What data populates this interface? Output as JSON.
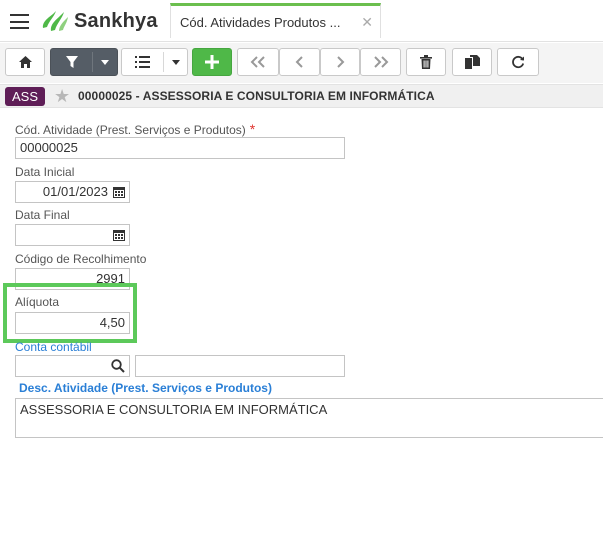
{
  "app": {
    "brand": "Sankhya"
  },
  "tab": {
    "label": "Cód. Atividades Produtos ...",
    "close": "✕"
  },
  "toolbar": {
    "buttons": [
      "home-icon",
      "filter-icon",
      "list-icon",
      "add-icon",
      "first-icon",
      "previous-icon",
      "next-icon",
      "last-icon",
      "delete-icon",
      "duplicate-icon",
      "refresh-icon"
    ]
  },
  "record": {
    "badge": "ASS",
    "title": "00000025 - ASSESSORIA E CONSULTORIA EM INFORMÁTICA"
  },
  "form": {
    "cod_atividade_label": "Cód. Atividade (Prest. Serviços e Produtos)",
    "cod_atividade_required": "*",
    "cod_atividade_value": "00000025",
    "data_inicial_label": "Data Inicial",
    "data_inicial_value": "01/01/2023",
    "data_final_label": "Data Final",
    "data_final_value": "",
    "codigo_recolhimento_label": "Código de Recolhimento",
    "codigo_recolhimento_value": "2991",
    "aliquota_label": "Alíquota",
    "aliquota_value": "4,50",
    "conta_contabil_label": "Conta contábil",
    "conta_contabil_code": "",
    "conta_contabil_desc": "",
    "desc_atividade_label": "Desc. Atividade (Prest. Serviços e Produtos)",
    "desc_atividade_value": "ASSESSORIA E CONSULTORIA EM INFORMÁTICA"
  },
  "colors": {
    "accent_green": "#4fb848",
    "highlight_green": "#5cc95a",
    "badge_purple": "#5f1e57",
    "link_blue": "#2a7fd6",
    "required_red": "#e0332e"
  }
}
